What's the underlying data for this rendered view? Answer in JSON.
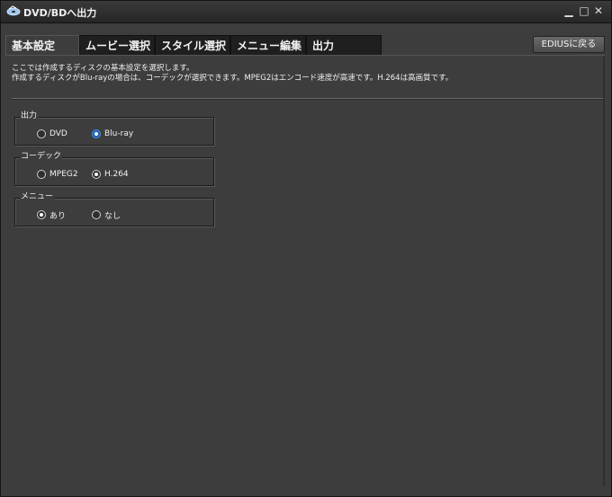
{
  "window": {
    "title": "DVD/BDへ出力",
    "controls": {
      "minimize": "▁",
      "maximize": "□",
      "close": "✕"
    }
  },
  "tabs": [
    {
      "label": "基本設定",
      "active": true
    },
    {
      "label": "ムービー選択",
      "active": false
    },
    {
      "label": "スタイル選択",
      "active": false
    },
    {
      "label": "メニュー編集",
      "active": false
    },
    {
      "label": "出力",
      "active": false
    }
  ],
  "back_button": {
    "label": "EDIUSに戻る"
  },
  "description": {
    "line1": "ここでは作成するディスクの基本設定を選択します。",
    "line2": "作成するディスクがBlu-rayの場合は、コーデックが選択できます。MPEG2はエンコード速度が高速です。H.264は高画質です。"
  },
  "groups": {
    "output": {
      "label": "出力",
      "options": [
        {
          "label": "DVD",
          "checked": false
        },
        {
          "label": "Blu-ray",
          "checked": true
        }
      ]
    },
    "codec": {
      "label": "コーデック",
      "options": [
        {
          "label": "MPEG2",
          "checked": false
        },
        {
          "label": "H.264",
          "checked": true
        }
      ]
    },
    "menu": {
      "label": "メニュー",
      "options": [
        {
          "label": "あり",
          "checked": true
        },
        {
          "label": "なし",
          "checked": false
        }
      ]
    }
  },
  "colors": {
    "background": "#3d3d3d",
    "titlebar": "#2a2a2a",
    "tab_inactive": "#1f1f1f",
    "accent_radio": "#3a8ee6",
    "text": "#f0f0f0"
  },
  "icons": {
    "app": "disc-icon"
  }
}
